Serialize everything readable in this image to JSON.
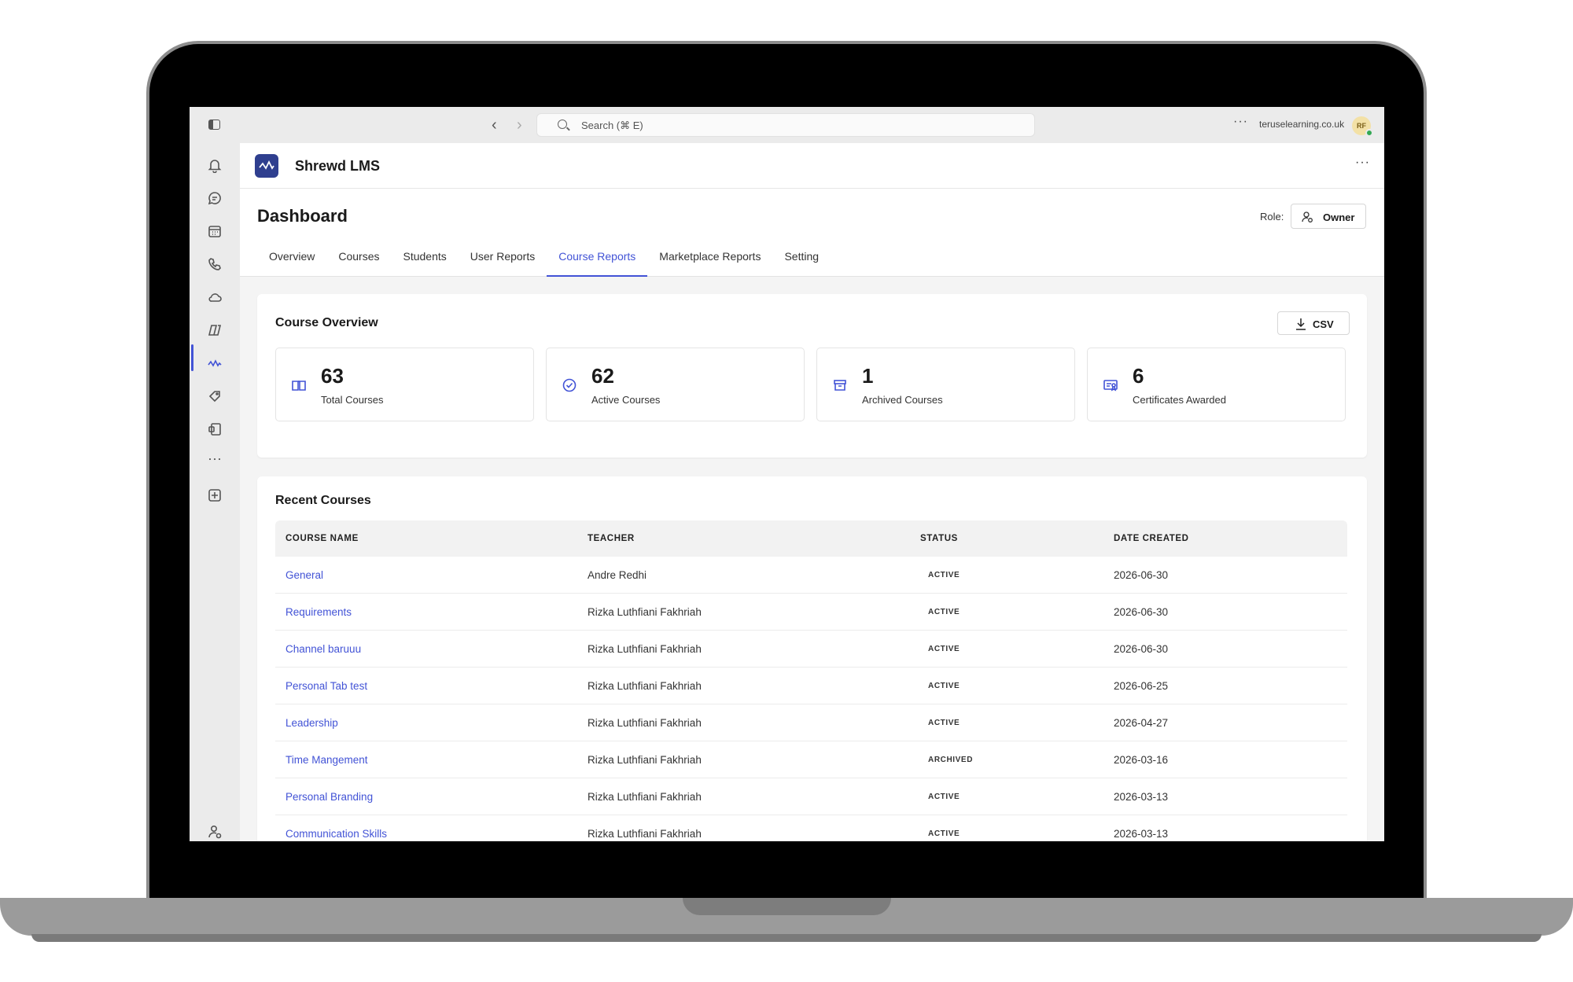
{
  "topbar": {
    "search_placeholder": "Search (⌘ E)",
    "domain": "teruselearning.co.uk",
    "avatar_initials": "RF"
  },
  "rail": {
    "icons": [
      "bell-icon",
      "chat-icon",
      "calendar-icon",
      "phone-icon",
      "cloud-icon",
      "copilot-icon",
      "shrewd-app-icon",
      "tag-icon",
      "notebook-icon",
      "more-apps-icon",
      "add-app-icon"
    ],
    "bottom_icon": "admin-user-icon"
  },
  "app": {
    "name": "Shrewd LMS",
    "accent": "#4253d6",
    "logo_bg": "#2f3f8f"
  },
  "dashboard": {
    "title": "Dashboard",
    "role_label": "Role:",
    "role_value": "Owner",
    "tabs": [
      "Overview",
      "Courses",
      "Students",
      "User Reports",
      "Course Reports",
      "Marketplace Reports",
      "Setting"
    ],
    "active_tab": "Course Reports"
  },
  "overview": {
    "title": "Course Overview",
    "csv_label": "CSV",
    "stats": [
      {
        "value": "63",
        "label": "Total Courses",
        "icon": "book-icon"
      },
      {
        "value": "62",
        "label": "Active Courses",
        "icon": "check-circle-icon"
      },
      {
        "value": "1",
        "label": "Archived Courses",
        "icon": "archive-icon"
      },
      {
        "value": "6",
        "label": "Certificates Awarded",
        "icon": "certificate-icon"
      }
    ]
  },
  "recent": {
    "title": "Recent Courses",
    "columns": [
      "COURSE NAME",
      "TEACHER",
      "STATUS",
      "DATE CREATED"
    ],
    "rows": [
      {
        "course": "General",
        "teacher": "Andre Redhi",
        "status": "ACTIVE",
        "date": "2026-06-30"
      },
      {
        "course": "Requirements",
        "teacher": "Rizka Luthfiani Fakhriah",
        "status": "ACTIVE",
        "date": "2026-06-30"
      },
      {
        "course": "Channel baruuu",
        "teacher": "Rizka Luthfiani Fakhriah",
        "status": "ACTIVE",
        "date": "2026-06-30"
      },
      {
        "course": "Personal Tab test",
        "teacher": "Rizka Luthfiani Fakhriah",
        "status": "ACTIVE",
        "date": "2026-06-25"
      },
      {
        "course": "Leadership",
        "teacher": "Rizka Luthfiani Fakhriah",
        "status": "ACTIVE",
        "date": "2026-04-27"
      },
      {
        "course": "Time Mangement",
        "teacher": "Rizka Luthfiani Fakhriah",
        "status": "ARCHIVED",
        "date": "2026-03-16"
      },
      {
        "course": "Personal Branding",
        "teacher": "Rizka Luthfiani Fakhriah",
        "status": "ACTIVE",
        "date": "2026-03-13"
      },
      {
        "course": "Communication Skills",
        "teacher": "Rizka Luthfiani Fakhriah",
        "status": "ACTIVE",
        "date": "2026-03-13"
      }
    ]
  }
}
